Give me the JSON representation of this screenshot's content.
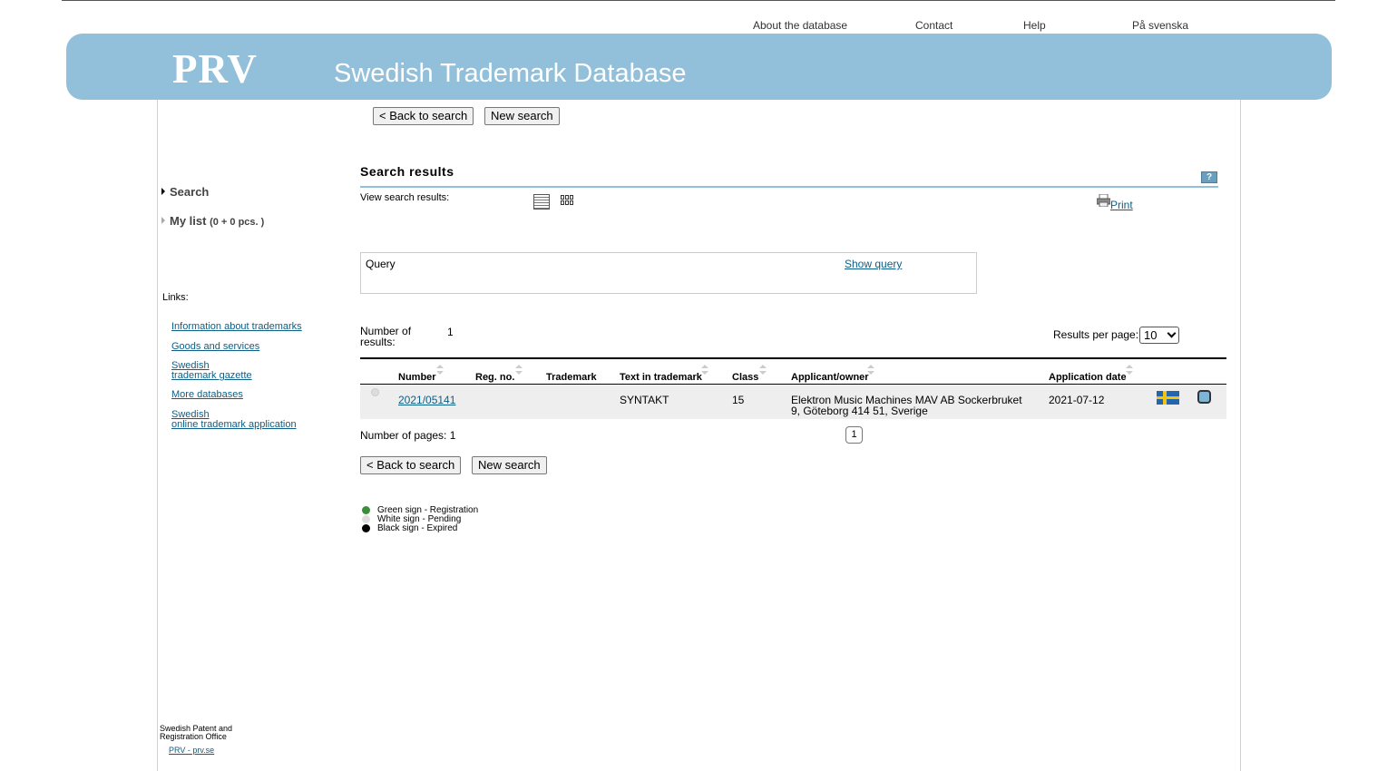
{
  "topnav": {
    "about": "About the database",
    "contact": "Contact",
    "help": "Help",
    "swedish": "På svenska",
    "plus": "+"
  },
  "banner": {
    "logo": "PRV",
    "title": "Swedish Trademark Database"
  },
  "buttons": {
    "back": "< Back to search",
    "new": "New search"
  },
  "sidebar": {
    "search": "Search",
    "mylist": "My list",
    "mylist_count": "(0 + 0 pcs. )",
    "links_label": "Links:",
    "links": [
      {
        "line1": "Information about trademarks",
        "line2": ""
      },
      {
        "line1": "Goods and services",
        "line2": ""
      },
      {
        "line1": "Swedish",
        "line2": "trademark gazette"
      },
      {
        "line1": "More databases",
        "line2": ""
      },
      {
        "line1": "Swedish",
        "line2": "online trademark application"
      }
    ],
    "footer_org_line1": "Swedish Patent and",
    "footer_org_line2": "Registration Office",
    "footer_link": "PRV - prv.se"
  },
  "results": {
    "title": "Search results",
    "help_icon": "?",
    "view_label": "View search results:",
    "print": "Print",
    "query_label": "Query",
    "show_query": "Show query",
    "number_label_line1": "Number of",
    "number_label_line2": "results:",
    "number_value": "1",
    "per_page_label": "Results per page:",
    "per_page_value": "10",
    "pages_label": "Number of pages: 1",
    "current_page": "1"
  },
  "table": {
    "headers": {
      "number": "Number",
      "reg_no": "Reg. no.",
      "trademark": "Trademark",
      "text": "Text in trademark",
      "class": "Class",
      "applicant": "Applicant/owner",
      "app_date": "Application date"
    },
    "rows": [
      {
        "number": "2021/05141",
        "reg_no": "",
        "trademark": "",
        "text": "SYNTAKT",
        "class": "15",
        "applicant_line1": "Elektron Music Machines MAV AB Sockerbruket",
        "applicant_line2": "9, Göteborg 414 51, Sverige",
        "app_date": "2021-07-12",
        "status": "pending",
        "country_flag": "sweden-flag-icon"
      }
    ]
  },
  "legend": [
    {
      "label": "Green sign - Registration",
      "color": "#3a8f3a"
    },
    {
      "label": "White sign - Pending",
      "color": "#dddddd"
    },
    {
      "label": "Black sign - Expired",
      "color": "#000000"
    }
  ],
  "colors": {
    "banner": "#92bfd9",
    "link": "#0d5e86"
  }
}
